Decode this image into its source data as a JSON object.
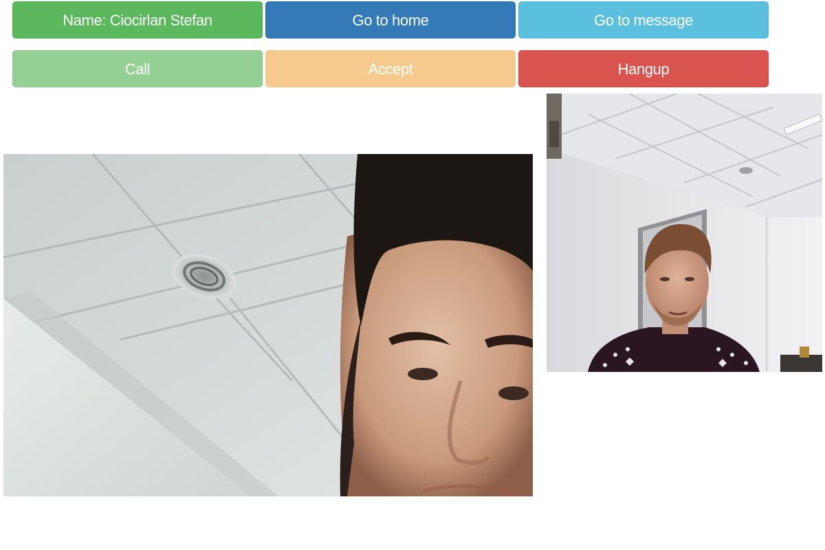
{
  "controls": {
    "name_label": "Name: Ciocirlan Stefan",
    "home_label": "Go to home",
    "message_label": "Go to message",
    "call_label": "Call",
    "accept_label": "Accept",
    "hangup_label": "Hangup"
  },
  "colors": {
    "name": "#5cb85c",
    "home": "#337ab7",
    "message": "#5bc0de",
    "call_disabled": "#94d094",
    "accept_disabled": "#f5ca8c",
    "hangup": "#d9534f"
  }
}
